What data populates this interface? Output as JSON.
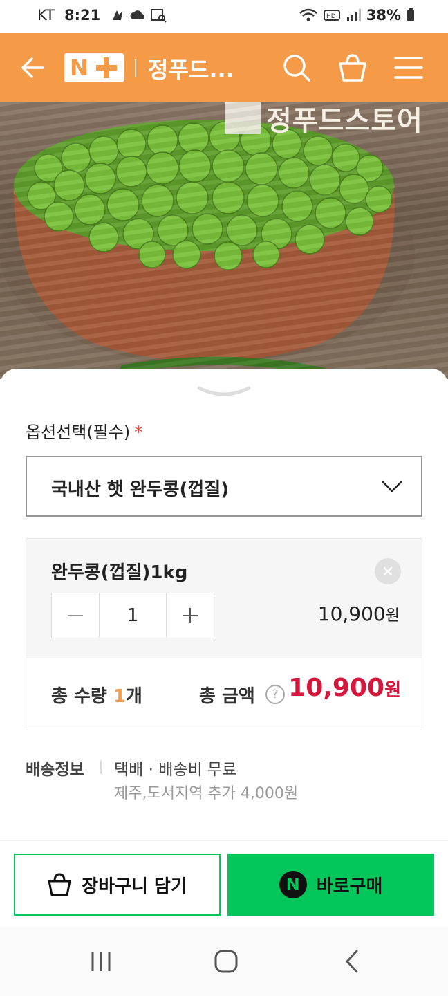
{
  "status_bar": {
    "carrier": "KT",
    "time": "8:21",
    "battery": "38%"
  },
  "header": {
    "store_title": "정푸드...",
    "icons": [
      "back-arrow-icon",
      "naver-plus-logo",
      "search-icon",
      "shopping-bag-icon",
      "menu-icon"
    ],
    "bg_color": "#f59a47"
  },
  "hero": {
    "watermark": "정푸드스토어"
  },
  "sheet": {
    "option_label": "옵션선택(필수)",
    "required_mark": "*",
    "selected_option": "국내산 햇 완두콩(껍질)",
    "item": {
      "name": "완두콩(껍질)1kg",
      "quantity": "1",
      "price": "10,900",
      "currency": "원"
    },
    "total": {
      "qty_label": "총 수량",
      "qty_value": "1",
      "qty_unit": "개",
      "amount_label": "총 금액",
      "amount": "10,900",
      "currency": "원",
      "help": "?"
    },
    "shipping": {
      "label": "배송정보",
      "method": "택배 · 배송비 무료",
      "extra": "제주,도서지역 추가 4,000원"
    }
  },
  "actions": {
    "cart_label": "장바구니 담기",
    "buy_label": "바로구매",
    "npay_letter": "N",
    "accent": "#03c75a"
  },
  "colors": {
    "price_red": "#d4183d",
    "qty_orange": "#f59a47"
  }
}
